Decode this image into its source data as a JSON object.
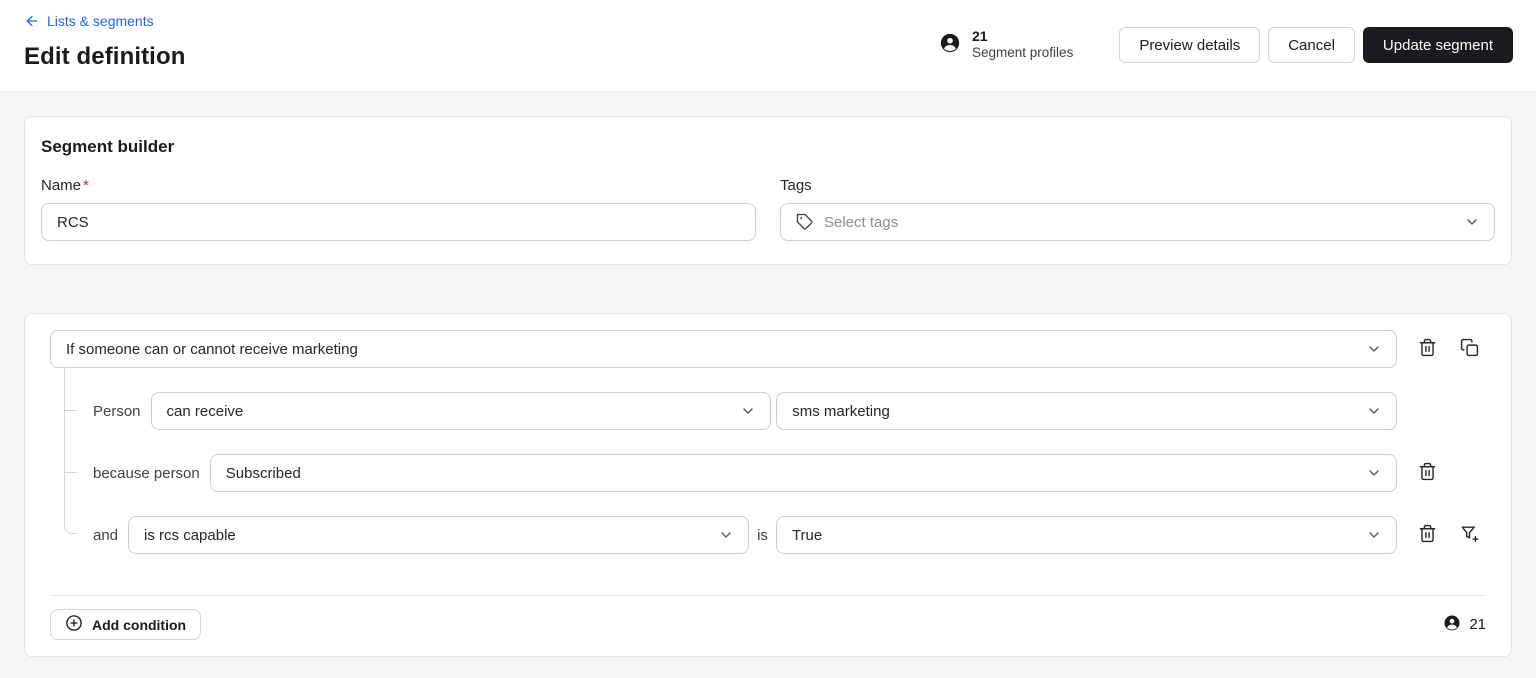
{
  "header": {
    "back_link": "Lists & segments",
    "title": "Edit definition",
    "profile_count": "21",
    "profile_label": "Segment profiles",
    "buttons": {
      "preview": "Preview details",
      "cancel": "Cancel",
      "update": "Update segment"
    }
  },
  "segment_builder": {
    "title": "Segment builder",
    "name_label": "Name",
    "name_required": "*",
    "name_value": "RCS",
    "tags_label": "Tags",
    "tags_placeholder": "Select tags"
  },
  "condition": {
    "trigger": "If someone can or cannot receive marketing",
    "person_row": {
      "label": "Person",
      "operator": "can receive",
      "channel": "sms marketing"
    },
    "consent_row": {
      "label": "because person",
      "value": "Subscribed"
    },
    "property_row": {
      "label": "and",
      "field": "is rcs capable",
      "comparator": "is",
      "value": "True"
    },
    "add_condition": "Add condition",
    "profile_count": "21"
  },
  "icons": {
    "back": "arrow-left-icon",
    "profiles": "person-icon",
    "tags": "tag-icon",
    "expand": "chevron-down-icon",
    "delete": "trash-icon",
    "duplicate": "copy-icon",
    "nested_filter": "filter-plus-icon",
    "add": "plus-circle-icon"
  },
  "colors": {
    "link_blue": "#2563eb",
    "primary_button_bg": "#1b1b1f",
    "required_red": "#dc2626",
    "content_bg": "#f6f6f7"
  }
}
